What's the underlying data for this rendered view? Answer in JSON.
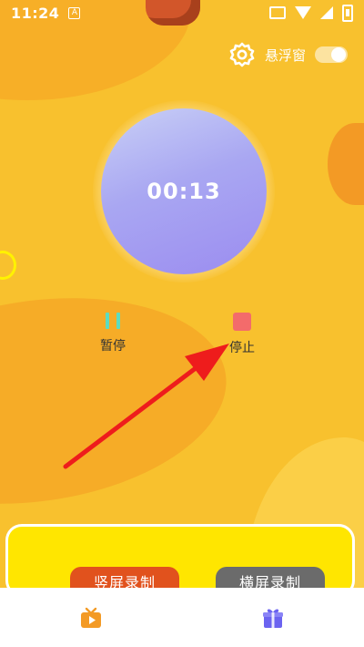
{
  "status_bar": {
    "time": "11:24",
    "app_badge": "A",
    "icons": [
      "cast-icon",
      "wifi-icon",
      "signal-icon",
      "battery-icon"
    ]
  },
  "header": {
    "settings_icon": "gear-icon",
    "float_window_label": "悬浮窗",
    "float_window_enabled": true
  },
  "timer": {
    "elapsed": "00:13"
  },
  "controls": {
    "pause_label": "暂停",
    "stop_label": "停止"
  },
  "record_buttons": {
    "portrait_label": "竖屏录制",
    "landscape_label": "横屏录制"
  },
  "tabbar": {
    "tabs": [
      {
        "icon": "tv-play-icon"
      },
      {
        "icon": "gift-icon"
      }
    ]
  },
  "colors": {
    "background": "#f8c12e",
    "timer_circle": "#a9a7f2",
    "pause": "#5ddcc0",
    "stop": "#f36b6b",
    "portrait_button": "#e1521d",
    "landscape_button": "#6b6b6b",
    "annotation_arrow": "#ee1c1c"
  }
}
